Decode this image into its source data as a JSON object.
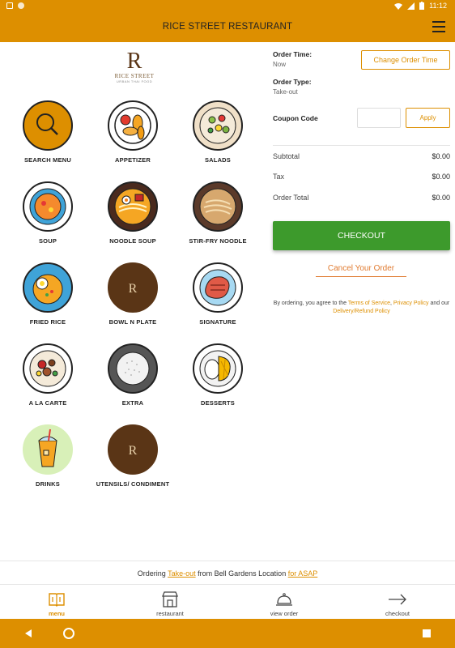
{
  "status": {
    "time": "11:12"
  },
  "app": {
    "title": "RICE STREET RESTAURANT"
  },
  "logo": {
    "mark": "R",
    "name": "RICE STREET",
    "tagline": "URBAN THAI FOOD"
  },
  "categories": [
    {
      "label": "SEARCH MENU",
      "icon": "search-icon"
    },
    {
      "label": "APPETIZER",
      "icon": "appetizer-icon"
    },
    {
      "label": "SALADS",
      "icon": "salad-icon"
    },
    {
      "label": "SOUP",
      "icon": "soup-icon"
    },
    {
      "label": "NOODLE SOUP",
      "icon": "noodle-soup-icon"
    },
    {
      "label": "STIR-FRY NOODLE",
      "icon": "stir-fry-noodle-icon"
    },
    {
      "label": "FRIED RICE",
      "icon": "fried-rice-icon"
    },
    {
      "label": "BOWL N PLATE",
      "icon": "rice-street-logo-icon"
    },
    {
      "label": "SIGNATURE",
      "icon": "steak-icon"
    },
    {
      "label": "A LA CARTE",
      "icon": "a-la-carte-icon"
    },
    {
      "label": "EXTRA",
      "icon": "rice-bowl-icon"
    },
    {
      "label": "DESSERTS",
      "icon": "mango-sticky-rice-icon"
    },
    {
      "label": "DRINKS",
      "icon": "drink-icon"
    },
    {
      "label": "UTENSILS/ CONDIMENT",
      "icon": "rice-street-logo-icon"
    }
  ],
  "order": {
    "time_label": "Order Time:",
    "time_value": "Now",
    "change_time_label": "Change Order Time",
    "type_label": "Order Type:",
    "type_value": "Take-out",
    "coupon_label": "Coupon Code",
    "coupon_value": "",
    "apply_label": "Apply",
    "subtotal_label": "Subtotal",
    "subtotal_value": "$0.00",
    "tax_label": "Tax",
    "tax_value": "$0.00",
    "total_label": "Order Total",
    "total_value": "$0.00",
    "checkout_label": "CHECKOUT",
    "cancel_label": "Cancel Your Order",
    "terms_prefix": "By ordering, you agree to the",
    "terms_link": "Terms of Service",
    "privacy_link": "Privacy Policy",
    "terms_and": "and our",
    "refund_link": "Delivery/Refund Policy"
  },
  "ordering_bar": {
    "prefix": "Ordering",
    "mode": "Take-out",
    "middle": "from Bell Gardens Location",
    "when": "for ASAP"
  },
  "nav": [
    {
      "label": "menu",
      "icon": "menu-book-icon"
    },
    {
      "label": "restaurant",
      "icon": "storefront-icon"
    },
    {
      "label": "view order",
      "icon": "cloche-icon"
    },
    {
      "label": "checkout",
      "icon": "arrow-right-icon"
    }
  ],
  "colors": {
    "brand": "#dd8f00",
    "checkout": "#3d9a2c",
    "cancel": "#e07a2f",
    "logo_brown": "#5a3516"
  }
}
